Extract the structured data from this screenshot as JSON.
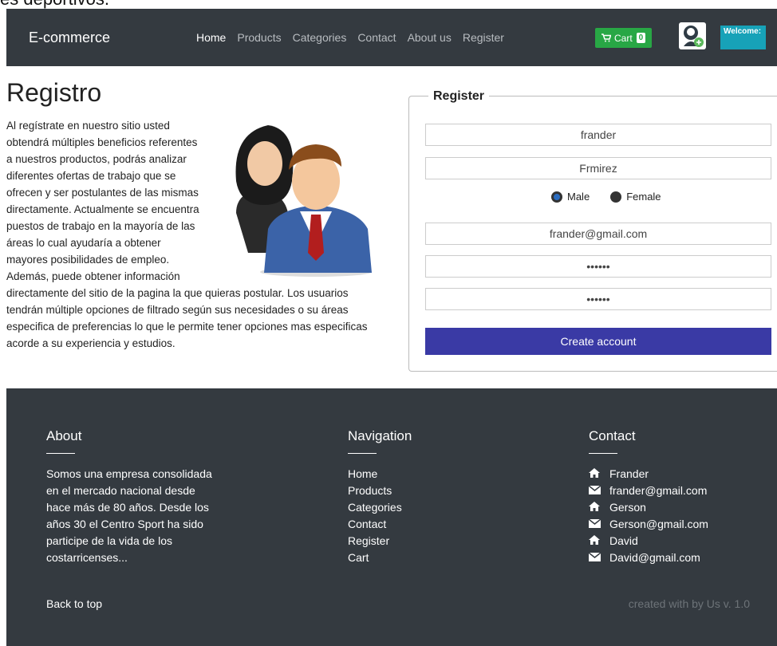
{
  "top_clip": "es deportivos.",
  "navbar": {
    "brand": "E-commerce",
    "links": [
      "Home",
      "Products",
      "Categories",
      "Contact",
      "About us",
      "Register"
    ],
    "cart_label": "Cart",
    "cart_count": "0",
    "welcome": "Welcome:"
  },
  "register": {
    "title": "Registro",
    "text": "Al regístrate en nuestro sitio usted obtendrá múltiples beneficios referentes a nuestros productos, podrás analizar diferentes ofertas de trabajo que se ofrecen y ser postulantes de las mismas directamente. Actualmente se encuentra puestos de trabajo en la mayoría de las áreas lo cual ayudaría a obtener mayores posibilidades de empleo. Además, puede obtener información directamente del sitio de la pagina la que quieras postular. Los usuarios tendrán múltiple opciones de filtrado según sus necesidades o su áreas especifica de preferencias lo que le permite tener opciones mas especificas acorde a su experiencia y estudios."
  },
  "form": {
    "legend": "Register",
    "first_name": "frander",
    "last_name": "Frmirez",
    "gender_male": "Male",
    "gender_female": "Female",
    "email": "frander@gmail.com",
    "password": "••••••",
    "confirm_password": "••••••",
    "submit": "Create account"
  },
  "footer": {
    "about_title": "About",
    "about_text": "Somos una empresa consolidada en el mercado nacional desde hace más de 80 años. Desde los años 30 el Centro Sport ha sido participe de la vida de los costarricenses...",
    "nav_title": "Navigation",
    "nav_links": [
      "Home",
      "Products",
      "Categories",
      "Contact",
      "Register",
      "Cart"
    ],
    "contact_title": "Contact",
    "contacts": [
      {
        "icon": "home-icon",
        "text": "Frander"
      },
      {
        "icon": "envelope-icon",
        "text": "frander@gmail.com"
      },
      {
        "icon": "home-icon",
        "text": "Gerson"
      },
      {
        "icon": "envelope-icon",
        "text": "Gerson@gmail.com"
      },
      {
        "icon": "home-icon",
        "text": "David"
      },
      {
        "icon": "envelope-icon",
        "text": "David@gmail.com"
      }
    ],
    "back_to_top": "Back to top",
    "credit": "created with by Us v. 1.0"
  },
  "colors": {
    "navbar": "#343a40",
    "cart": "#28a745",
    "welcome": "#17a2b8",
    "submit": "#3a3aa5"
  }
}
